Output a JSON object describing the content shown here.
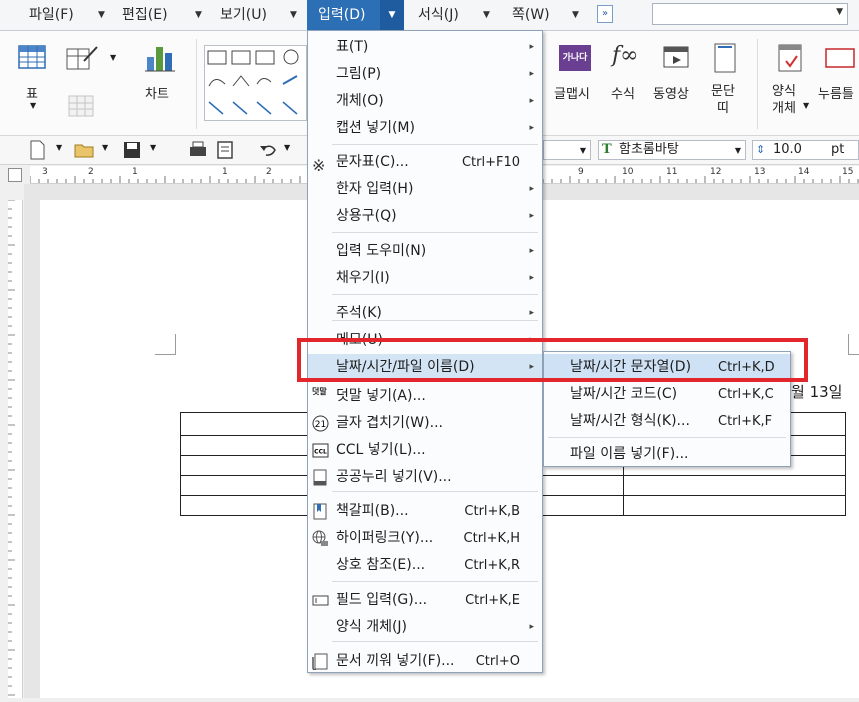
{
  "menubar": {
    "items": [
      "파일(F)",
      "편집(E)",
      "보기(U)",
      "입력(D)",
      "서식(J)",
      "쪽(W)"
    ],
    "more": "»"
  },
  "ribbon": {
    "table": "표",
    "chart": "차트",
    "charshape": "글맵시",
    "formula": "수식",
    "video": "동영상",
    "paragraph": "문단\n띠",
    "form_object": "양식\n개체",
    "push": "누름틀",
    "formula_glyph": "f∞",
    "charshape_glyph": "가나다"
  },
  "toolbar2": {
    "font_name": "함초롬바탕",
    "font_size": "10.0",
    "font_unit": "pt",
    "font_icon": "T"
  },
  "ruler": {
    "numbers": [
      "3",
      "2",
      "1",
      "1",
      "2",
      "3",
      "9",
      "10",
      "11",
      "12",
      "13",
      "14",
      "15"
    ]
  },
  "document": {
    "date_fragment": "월 13일"
  },
  "insert_menu": {
    "items": [
      {
        "label": "표(T)",
        "shortcut": "",
        "submenu": true
      },
      {
        "label": "그림(P)",
        "shortcut": "",
        "submenu": true
      },
      {
        "label": "개체(O)",
        "shortcut": "",
        "submenu": true
      },
      {
        "label": "캡션 넣기(M)",
        "shortcut": "",
        "submenu": true
      },
      {
        "label": "문자표(C)...",
        "shortcut": "Ctrl+F10",
        "submenu": false
      },
      {
        "label": "한자 입력(H)",
        "shortcut": "",
        "submenu": true
      },
      {
        "label": "상용구(Q)",
        "shortcut": "",
        "submenu": true
      },
      {
        "label": "입력 도우미(N)",
        "shortcut": "",
        "submenu": true
      },
      {
        "label": "채우기(I)",
        "shortcut": "",
        "submenu": true
      },
      {
        "label": "주석(K)",
        "shortcut": "",
        "submenu": true
      },
      {
        "label": "메모(U)",
        "shortcut": "",
        "submenu": true
      },
      {
        "label": "날짜/시간/파일 이름(D)",
        "shortcut": "",
        "submenu": true
      },
      {
        "label": "덧말 넣기(A)...",
        "shortcut": "",
        "submenu": false
      },
      {
        "label": "글자 겹치기(W)...",
        "shortcut": "",
        "submenu": false
      },
      {
        "label": "CCL 넣기(L)...",
        "shortcut": "",
        "submenu": false
      },
      {
        "label": "공공누리 넣기(V)...",
        "shortcut": "",
        "submenu": false
      },
      {
        "label": "책갈피(B)...",
        "shortcut": "Ctrl+K,B",
        "submenu": false
      },
      {
        "label": "하이퍼링크(Y)...",
        "shortcut": "Ctrl+K,H",
        "submenu": false
      },
      {
        "label": "상호 참조(E)...",
        "shortcut": "Ctrl+K,R",
        "submenu": false
      },
      {
        "label": "필드 입력(G)...",
        "shortcut": "Ctrl+K,E",
        "submenu": false
      },
      {
        "label": "양식 개체(J)",
        "shortcut": "",
        "submenu": true
      },
      {
        "label": "문서 끼워 넣기(F)...",
        "shortcut": "Ctrl+O",
        "submenu": false
      }
    ],
    "icon_glyphs": {
      "char_table": "※",
      "ruby": "덧말",
      "overlap": "21",
      "ccl": "CCL"
    }
  },
  "date_submenu": {
    "items": [
      {
        "label": "날짜/시간 문자열(D)",
        "shortcut": "Ctrl+K,D"
      },
      {
        "label": "날짜/시간 코드(C)",
        "shortcut": "Ctrl+K,C"
      },
      {
        "label": "날짜/시간 형식(K)...",
        "shortcut": "Ctrl+K,F"
      },
      {
        "label": "파일 이름 넣기(F)...",
        "shortcut": ""
      }
    ]
  },
  "colors": {
    "active_menu": "#2c6fb4",
    "highlight": "#d3e4f5",
    "annotation_red": "#e3262b"
  }
}
